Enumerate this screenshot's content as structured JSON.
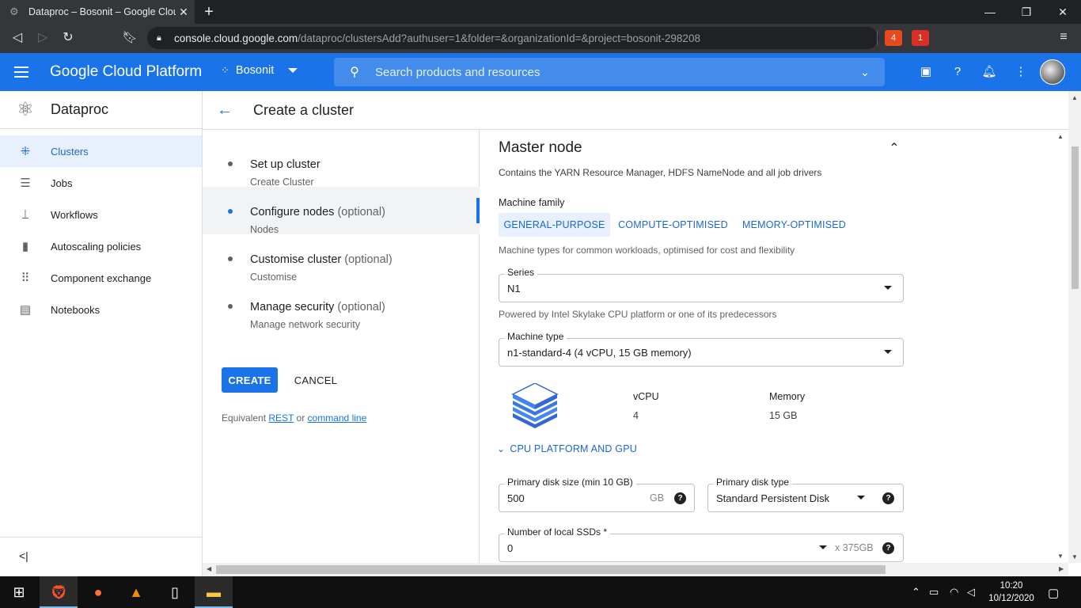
{
  "browser": {
    "tab_title": "Dataproc – Bosonit – Google Clou",
    "url_host": "console.cloud.google.com",
    "url_path": "/dataproc/clustersAdd?authuser=1&folder=&organizationId=&project=bosonit-298208",
    "brave_badge": "4",
    "alert_badge": "1"
  },
  "header": {
    "title": "Google Cloud Platform",
    "project": "Bosonit",
    "search_placeholder": "Search products and resources"
  },
  "sidebar": {
    "product": "Dataproc",
    "items": [
      {
        "label": "Clusters",
        "icon": "clusters-icon"
      },
      {
        "label": "Jobs",
        "icon": "list-icon"
      },
      {
        "label": "Workflows",
        "icon": "workflow-icon"
      },
      {
        "label": "Autoscaling policies",
        "icon": "bar-chart-icon"
      },
      {
        "label": "Component exchange",
        "icon": "grid-icon"
      },
      {
        "label": "Notebooks",
        "icon": "document-icon"
      }
    ],
    "collapse": "<|"
  },
  "page": {
    "title": "Create a cluster"
  },
  "steps": [
    {
      "title": "Set up cluster",
      "optional": "",
      "sub": "Create Cluster"
    },
    {
      "title": "Configure nodes",
      "optional": "(optional)",
      "sub": "Nodes"
    },
    {
      "title": "Customise cluster",
      "optional": "(optional)",
      "sub": "Customise"
    },
    {
      "title": "Manage security",
      "optional": "(optional)",
      "sub": "Manage network security"
    }
  ],
  "actions": {
    "create": "CREATE",
    "cancel": "CANCEL",
    "equiv_prefix": "Equivalent",
    "rest": "REST",
    "or": "or",
    "cmdline": "command line"
  },
  "form": {
    "section_title": "Master node",
    "section_desc": "Contains the YARN Resource Manager, HDFS NameNode and all job drivers",
    "machine_family_label": "Machine family",
    "families": [
      "GENERAL-PURPOSE",
      "COMPUTE-OPTIMISED",
      "MEMORY-OPTIMISED"
    ],
    "family_help": "Machine types for common workloads, optimised for cost and flexibility",
    "series_label": "Series",
    "series_value": "N1",
    "series_help": "Powered by Intel Skylake CPU platform or one of its predecessors",
    "machine_type_label": "Machine type",
    "machine_type_value": "n1-standard-4 (4 vCPU, 15 GB memory)",
    "vcpu_label": "vCPU",
    "vcpu_value": "4",
    "memory_label": "Memory",
    "memory_value": "15 GB",
    "cpu_gpu": "CPU PLATFORM AND GPU",
    "disk_size_label": "Primary disk size (min 10 GB)",
    "disk_size_value": "500",
    "disk_size_unit": "GB",
    "disk_type_label": "Primary disk type",
    "disk_type_value": "Standard Persistent Disk",
    "ssd_label": "Number of local SSDs *",
    "ssd_value": "0",
    "ssd_unit": "x 375GB"
  },
  "taskbar": {
    "time": "10:20",
    "date": "10/12/2020"
  },
  "colors": {
    "brand_blue": "#1a73e8",
    "active_bg": "#e8f0fe"
  }
}
